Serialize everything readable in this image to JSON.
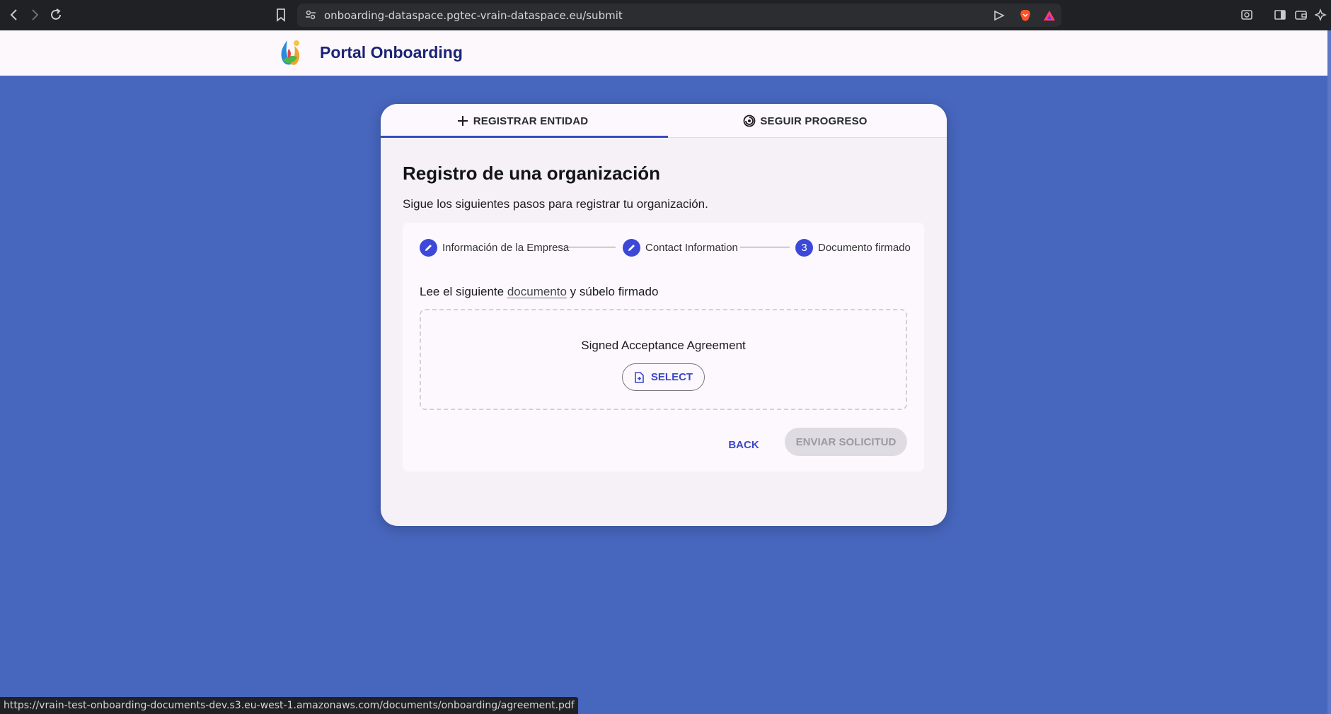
{
  "browser": {
    "url": "onboarding-dataspace.pgtec-vrain-dataspace.eu/submit",
    "status_url": "https://vrain-test-onboarding-documents-dev.s3.eu-west-1.amazonaws.com/documents/onboarding/agreement.pdf",
    "icons": [
      "back-icon",
      "forward-icon",
      "reload-icon",
      "bookmark-icon",
      "site-settings-icon",
      "send-icon",
      "brave-shield-icon",
      "brave-rewards-icon",
      "screenshot-icon",
      "sidebar-icon",
      "wallet-icon",
      "leo-ai-icon"
    ]
  },
  "header": {
    "title": "Portal Onboarding"
  },
  "tabs": [
    {
      "label": "REGISTRAR ENTIDAD",
      "icon": "plus-icon",
      "active": true
    },
    {
      "label": "SEGUIR PROGRESO",
      "icon": "progress-icon",
      "active": false
    }
  ],
  "form": {
    "title": "Registro de una organización",
    "subtitle": "Sigue los siguientes pasos para registrar tu organización.",
    "steps": [
      {
        "label": "Información de la Empresa",
        "state": "completed",
        "icon": "pencil-icon"
      },
      {
        "label": "Contact Information",
        "state": "completed",
        "icon": "pencil-icon"
      },
      {
        "label": "Documento firmado",
        "state": "active",
        "number": "3"
      }
    ],
    "instruction_before": "Lee el siguiente ",
    "instruction_link": "documento",
    "instruction_after": " y súbelo firmado",
    "upload": {
      "label": "Signed Acceptance Agreement",
      "button_label": "SELECT",
      "button_icon": "file-upload-icon"
    },
    "back_label": "BACK",
    "submit_label": "ENVIAR SOLICITUD",
    "submit_disabled": true
  },
  "colors": {
    "page_background": "#4766bd",
    "accent": "#3c48d8",
    "title": "#1b2475"
  }
}
